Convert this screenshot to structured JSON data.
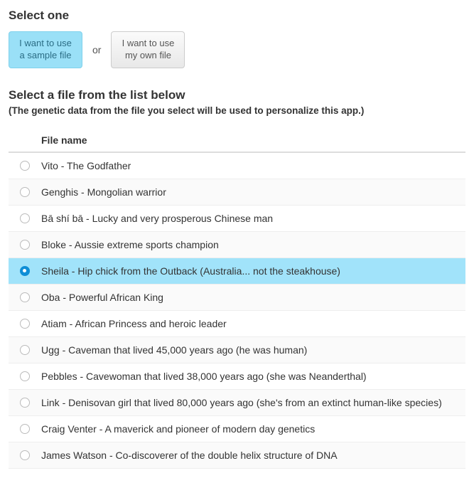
{
  "section1": {
    "heading": "Select one",
    "option_sample": "I want to use a sample file",
    "or": "or",
    "option_own": "I want to use my own file",
    "selected": "sample"
  },
  "section2": {
    "heading": "Select a file from the list below",
    "subheading": "(The genetic data from the file you select will be used to personalize this app.)",
    "column_header": "File name",
    "selected_index": 4,
    "files": [
      "Vito - The Godfather",
      "Genghis - Mongolian warrior",
      "Bā shí bā - Lucky and very prosperous Chinese man",
      "Bloke - Aussie extreme sports champion",
      "Sheila - Hip chick from the Outback (Australia... not the steakhouse)",
      "Oba - Powerful African King",
      "Atiam - African Princess and heroic leader",
      "Ugg - Caveman that lived 45,000 years ago (he was human)",
      "Pebbles - Cavewoman that lived 38,000 years ago (she was Neanderthal)",
      "Link - Denisovan girl that lived 80,000 years ago (she's from an extinct human-like species)",
      "Craig Venter - A maverick and pioneer of modern day genetics",
      "James Watson - Co-discoverer of the double helix structure of DNA"
    ]
  }
}
